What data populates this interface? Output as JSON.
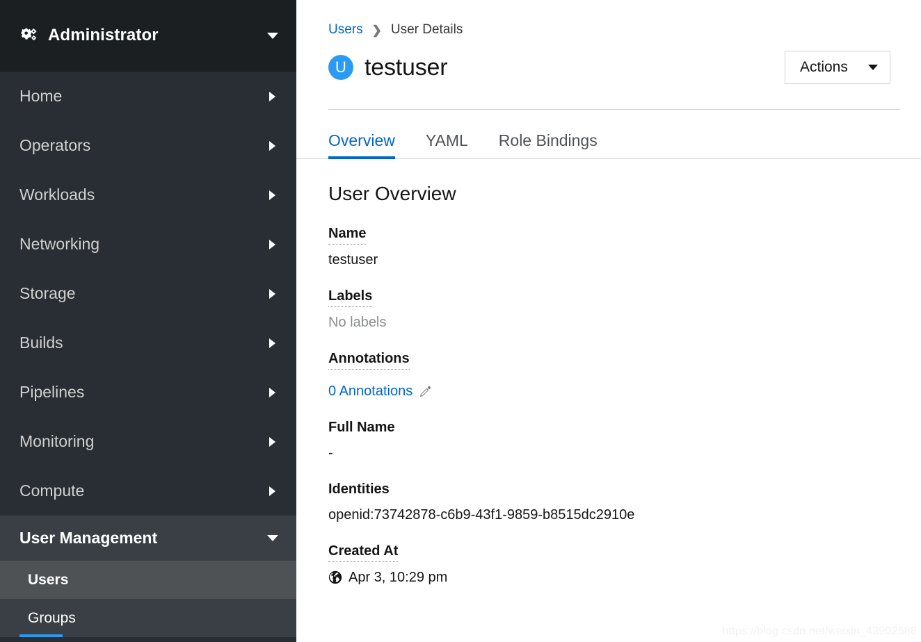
{
  "sidebar": {
    "perspective": {
      "label": "Administrator",
      "icon": "cogs-icon",
      "caret": "caret-down-icon"
    },
    "items": [
      {
        "label": "Home",
        "icon": "chevron-right-icon"
      },
      {
        "label": "Operators",
        "icon": "chevron-right-icon"
      },
      {
        "label": "Workloads",
        "icon": "chevron-right-icon"
      },
      {
        "label": "Networking",
        "icon": "chevron-right-icon"
      },
      {
        "label": "Storage",
        "icon": "chevron-right-icon"
      },
      {
        "label": "Builds",
        "icon": "chevron-right-icon"
      },
      {
        "label": "Pipelines",
        "icon": "chevron-right-icon"
      },
      {
        "label": "Monitoring",
        "icon": "chevron-right-icon"
      },
      {
        "label": "Compute",
        "icon": "chevron-right-icon"
      }
    ],
    "expanded_section": {
      "label": "User Management",
      "icon": "chevron-down-icon",
      "subitems": [
        {
          "label": "Users",
          "active": true
        },
        {
          "label": "Groups",
          "active": false
        }
      ]
    },
    "accent_color": "#2b9af3"
  },
  "header": {
    "breadcrumb": {
      "parent": "Users",
      "separator": "›",
      "current": "User Details"
    },
    "avatar_letter": "U",
    "avatar_color": "#2b9af3",
    "title": "testuser",
    "actions": {
      "label": "Actions",
      "caret": "caret-down-icon"
    }
  },
  "tabs": [
    {
      "label": "Overview",
      "active": true
    },
    {
      "label": "YAML",
      "active": false
    },
    {
      "label": "Role Bindings",
      "active": false
    }
  ],
  "overview": {
    "title": "User Overview",
    "fields": [
      {
        "label": "Name",
        "hint": true,
        "value": "testuser",
        "style": "plain"
      },
      {
        "label": "Labels",
        "hint": true,
        "value": "No labels",
        "style": "muted"
      },
      {
        "label": "Annotations",
        "hint": true,
        "value": "0 Annotations",
        "style": "link",
        "icon": "pencil-icon"
      },
      {
        "label": "Full Name",
        "hint": false,
        "value": "-",
        "style": "plain"
      },
      {
        "label": "Identities",
        "hint": false,
        "value": "openid:73742878-c6b9-43f1-9859-b8515dc2910e",
        "style": "plain"
      },
      {
        "label": "Created At",
        "hint": true,
        "value": "Apr 3, 10:29 pm",
        "style": "timestamp",
        "icon": "globe-icon"
      }
    ]
  },
  "watermark": "https://blog.csdn.net/weixin_43902588"
}
